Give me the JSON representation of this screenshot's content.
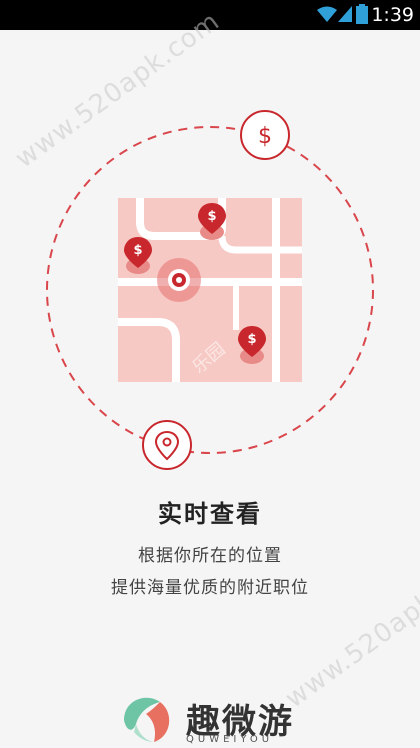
{
  "status_bar": {
    "time": "1:39",
    "icons": [
      "wifi-icon",
      "signal-icon",
      "battery-icon"
    ]
  },
  "watermark": {
    "text": "www.520apk.com"
  },
  "illustration": {
    "top_icon": "dollar-icon",
    "bottom_icon": "location-pin-icon",
    "map_watermark": "乐园",
    "accent_color": "#c8282d",
    "map_color": "#f7c9c4"
  },
  "onboarding": {
    "title": "实时查看",
    "line1": "根据你所在的位置",
    "line2": "提供海量优质的附近职位"
  },
  "brand": {
    "name": "趣微游",
    "sub": "QUWEIYOU"
  }
}
